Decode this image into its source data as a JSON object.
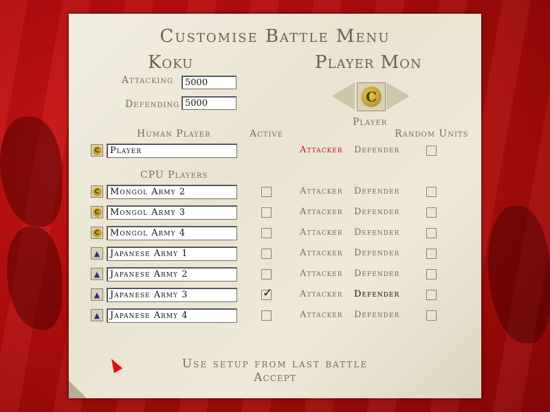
{
  "menu": {
    "title": "Customise Battle Menu",
    "koku_title": "Koku",
    "player_mon_title": "Player Mon",
    "attacking_label": "Attacking",
    "attacking_value": "5000",
    "defending_label": "Defending",
    "defending_value": "5000"
  },
  "headers": {
    "human_player": "Human Player",
    "active": "Active",
    "player": "Player",
    "random_units": "Random Units",
    "cpu_players": "CPU Players"
  },
  "labels": {
    "attacker": "Attacker",
    "defender": "Defender"
  },
  "human": {
    "name": "Player",
    "icon": "mongol-mon-icon",
    "role_selected": "attacker",
    "random": false
  },
  "cpu": [
    {
      "name": "Mongol Army 2",
      "icon": "mongol-mon-icon",
      "active": false,
      "role_selected": "",
      "random": false
    },
    {
      "name": "Mongol Army 3",
      "icon": "mongol-mon-icon",
      "active": false,
      "role_selected": "",
      "random": false
    },
    {
      "name": "Mongol Army 4",
      "icon": "mongol-mon-icon",
      "active": false,
      "role_selected": "",
      "random": false
    },
    {
      "name": "Japanese Army 1",
      "icon": "japanese-mon-icon",
      "active": false,
      "role_selected": "",
      "random": false
    },
    {
      "name": "Japanese Army 2",
      "icon": "japanese-mon-icon",
      "active": false,
      "role_selected": "",
      "random": false
    },
    {
      "name": "Japanese Army 3",
      "icon": "japanese-mon-icon",
      "active": true,
      "role_selected": "defender",
      "random": false
    },
    {
      "name": "Japanese Army 4",
      "icon": "japanese-mon-icon",
      "active": false,
      "role_selected": "",
      "random": false
    }
  ],
  "footer": {
    "setup_label": "Use setup from last battle",
    "accept_label": "Accept"
  },
  "colors": {
    "selected_attacker": "#cc1111",
    "selected_defender": "#111111",
    "label": "#7a6a4e"
  }
}
